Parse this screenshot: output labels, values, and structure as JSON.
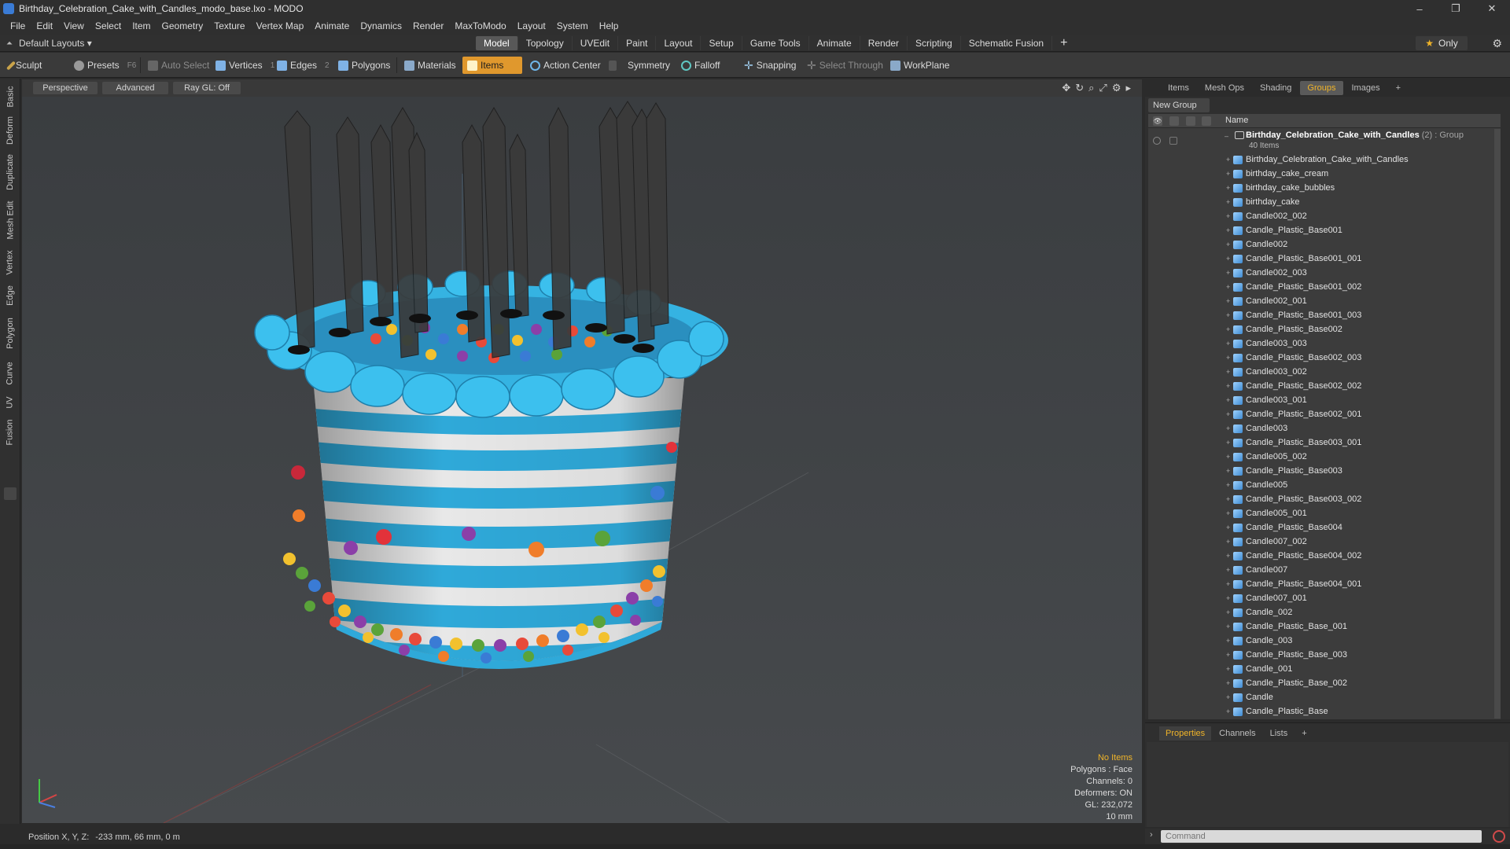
{
  "window": {
    "title": "Birthday_Celebration_Cake_with_Candles_modo_base.lxo - MODO",
    "controls": [
      "–",
      "❐",
      "✕"
    ]
  },
  "menu": [
    "File",
    "Edit",
    "View",
    "Select",
    "Item",
    "Geometry",
    "Texture",
    "Vertex Map",
    "Animate",
    "Dynamics",
    "Render",
    "MaxToModo",
    "Layout",
    "System",
    "Help"
  ],
  "layout_bar": {
    "layouts_label": "Default Layouts ▾",
    "tabs": [
      "Model",
      "Topology",
      "UVEdit",
      "Paint",
      "Layout",
      "Setup",
      "Game Tools",
      "Animate",
      "Render",
      "Scripting",
      "Schematic Fusion"
    ],
    "active_tab": "Model",
    "add_tab": "+",
    "only_label": "Only"
  },
  "toolbar": {
    "sculpt": "Sculpt",
    "presets": "Presets",
    "presets_key": "F6",
    "auto_select": "Auto Select",
    "vertices": "Vertices",
    "vertices_count": "1",
    "edges": "Edges",
    "edges_count": "2",
    "polygons": "Polygons",
    "materials": "Materials",
    "items": "Items",
    "action_center": "Action Center",
    "symmetry": "Symmetry",
    "falloff": "Falloff",
    "snapping": "Snapping",
    "select_through": "Select Through",
    "workplane": "WorkPlane"
  },
  "left_tabs": [
    "Basic",
    "Deform",
    "Duplicate",
    "Mesh Edit",
    "Vertex",
    "Edge",
    "Polygon",
    "Curve",
    "UV",
    "Fusion"
  ],
  "viewport": {
    "view_mode": "Perspective",
    "shading": "Advanced",
    "raygl": "Ray GL: Off",
    "info": {
      "selection": "No Items",
      "polygons": "Polygons : Face",
      "channels": "Channels: 0",
      "deformers": "Deformers: ON",
      "gl": "GL: 232,072",
      "scale": "10 mm"
    },
    "colors": {
      "background": "#3e4144",
      "frosting": "#2fa9d9",
      "stripe_white": "#e8e8e8",
      "candle": "#3a3a3a"
    }
  },
  "status": {
    "label": "Position X, Y, Z:",
    "value": "-233 mm, 66 mm, 0 m"
  },
  "right_panel": {
    "tabs": [
      "Items",
      "Mesh Ops",
      "Shading",
      "Groups",
      "Images",
      "+"
    ],
    "active_tab": "Groups",
    "new_group": "New Group",
    "column_name": "Name",
    "group": {
      "name": "Birthday_Celebration_Cake_with_Candles",
      "suffix": "(2) : Group",
      "count": "40 Items"
    },
    "items": [
      "Birthday_Celebration_Cake_with_Candles",
      "birthday_cake_cream",
      "birthday_cake_bubbles",
      "birthday_cake",
      "Candle002_002",
      "Candle_Plastic_Base001",
      "Candle002",
      "Candle_Plastic_Base001_001",
      "Candle002_003",
      "Candle_Plastic_Base001_002",
      "Candle002_001",
      "Candle_Plastic_Base001_003",
      "Candle_Plastic_Base002",
      "Candle003_003",
      "Candle_Plastic_Base002_003",
      "Candle003_002",
      "Candle_Plastic_Base002_002",
      "Candle003_001",
      "Candle_Plastic_Base002_001",
      "Candle003",
      "Candle_Plastic_Base003_001",
      "Candle005_002",
      "Candle_Plastic_Base003",
      "Candle005",
      "Candle_Plastic_Base003_002",
      "Candle005_001",
      "Candle_Plastic_Base004",
      "Candle007_002",
      "Candle_Plastic_Base004_002",
      "Candle007",
      "Candle_Plastic_Base004_001",
      "Candle007_001",
      "Candle_002",
      "Candle_Plastic_Base_001",
      "Candle_003",
      "Candle_Plastic_Base_003",
      "Candle_001",
      "Candle_Plastic_Base_002",
      "Candle",
      "Candle_Plastic_Base"
    ]
  },
  "properties_panel": {
    "tabs": [
      "Properties",
      "Channels",
      "Lists",
      "+"
    ],
    "active_tab": "Properties"
  },
  "command": {
    "placeholder": "Command"
  },
  "accent_color": "#e0982d"
}
